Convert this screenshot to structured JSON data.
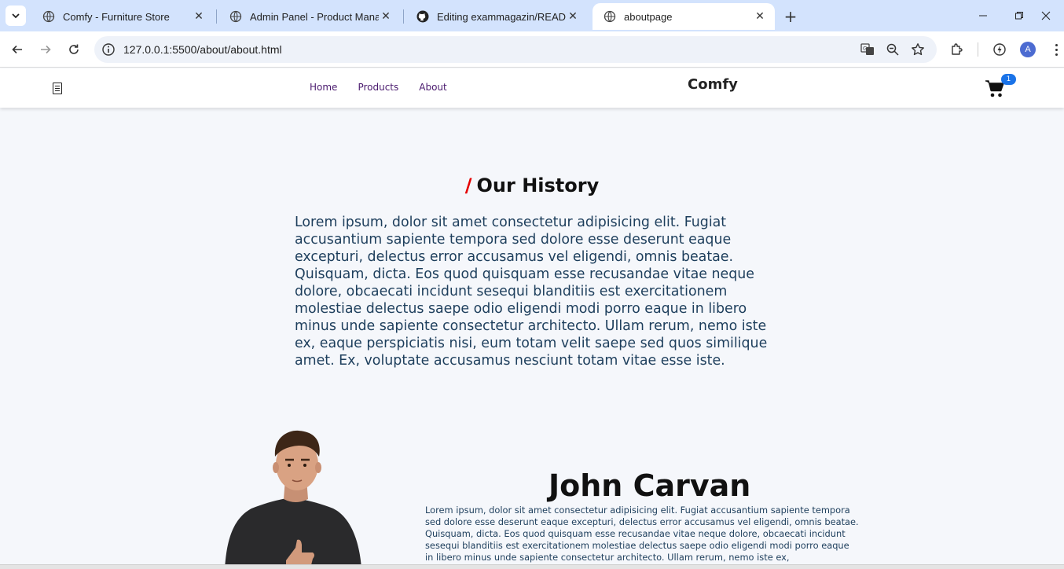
{
  "browser": {
    "tabs": [
      {
        "title": "Comfy - Furniture Store",
        "icon": "globe-icon",
        "active": false
      },
      {
        "title": "Admin Panel - Product Manage",
        "icon": "globe-icon",
        "active": false
      },
      {
        "title": "Editing exammagazin/README.",
        "icon": "github-icon",
        "active": false
      },
      {
        "title": "aboutpage",
        "icon": "globe-icon",
        "active": true
      }
    ],
    "new_tab_label": "+",
    "url": "127.0.0.1:5500/about/about.html",
    "profile_initial": "A"
  },
  "site": {
    "brand": "Comfy",
    "nav": [
      "Home",
      "Products",
      "About"
    ],
    "cart_count": "1",
    "accent_color": "#e50000"
  },
  "history": {
    "slash": "/",
    "title": "Our History",
    "text": "Lorem ipsum, dolor sit amet consectetur adipisicing elit. Fugiat accusantium sapiente tempora sed dolore esse deserunt eaque excepturi, delectus error accusamus vel eligendi, omnis beatae. Quisquam, dicta. Eos quod quisquam esse recusandae vitae neque dolore, obcaecati incidunt sesequi blanditiis est exercitationem molestiae delectus saepe odio eligendi modi porro eaque in libero minus unde sapiente consectetur architecto. Ullam rerum, nemo iste ex, eaque perspiciatis nisi, eum totam velit saepe sed quos similique amet. Ex, voluptate accusamus nesciunt totam vitae esse iste."
  },
  "person": {
    "name": "John Carvan",
    "text": "Lorem ipsum, dolor sit amet consectetur adipisicing elit. Fugiat accusantium sapiente tempora sed dolore esse deserunt eaque excepturi, delectus error accusamus vel eligendi, omnis beatae. Quisquam, dicta. Eos quod quisquam esse recusandae vitae neque dolore, obcaecati incidunt sesequi blanditiis est exercitationem molestiae delectus saepe odio eligendi modi porro eaque in libero minus unde sapiente consectetur architecto. Ullam rerum, nemo iste ex,"
  }
}
